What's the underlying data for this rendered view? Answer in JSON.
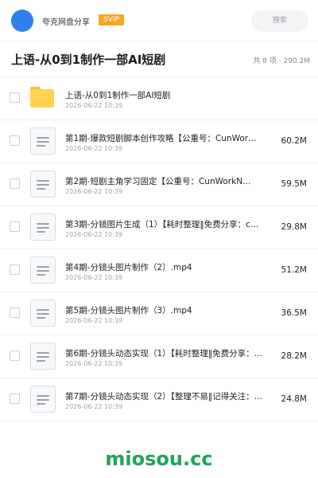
{
  "header": {
    "brand": "夸克网盘分享",
    "badge": "SVIP",
    "search_placeholder": "搜索"
  },
  "folder": {
    "title": "上语-从0到1制作一部AI短剧",
    "meta": "共 8 项 · 290.2M"
  },
  "items": [
    {
      "type": "folder",
      "icon": "folder-icon",
      "name": "上语-从0到1制作一部AI短剧",
      "date": "2026-06-22 10:39",
      "size": ""
    },
    {
      "type": "file",
      "icon": "document-icon",
      "name": "第1期-爆款短剧脚本创作攻略【公重号：CunWor…",
      "date": "2026-06-22 10:39",
      "size": "60.2M"
    },
    {
      "type": "file",
      "icon": "document-icon",
      "name": "第2期-短剧主角学习固定【公重号：CunWorkN…",
      "date": "2026-06-22 10:39",
      "size": "59.5M"
    },
    {
      "type": "file",
      "icon": "document-icon",
      "name": "第3期-分镜图片生成（1）【耗时整理‖免费分享：c…",
      "date": "2026-06-22 10:39",
      "size": "29.8M"
    },
    {
      "type": "file",
      "icon": "document-icon",
      "name": "第4期-分镜头图片制作（2）.mp4",
      "date": "2026-06-22 10:39",
      "size": "51.2M"
    },
    {
      "type": "file",
      "icon": "document-icon",
      "name": "第5期-分镜头图片制作（3）.mp4",
      "date": "2026-06-22 10:39",
      "size": "36.5M"
    },
    {
      "type": "file",
      "icon": "document-icon",
      "name": "第6期-分镜头动态实现（1）【耗时整理‖免费分享：…",
      "date": "2026-06-22 10:39",
      "size": "28.2M"
    },
    {
      "type": "file",
      "icon": "document-icon",
      "name": "第7期-分镜头动态实现（2）【整理不易‖记得关注：…",
      "date": "2026-06-22 10:39",
      "size": "24.8M"
    }
  ],
  "watermark": "miosou.cc",
  "colors": {
    "avatar": "#2f80ed",
    "badge": "#f5a623",
    "folder": "#ffd34e",
    "watermark": "#1ea35b"
  }
}
